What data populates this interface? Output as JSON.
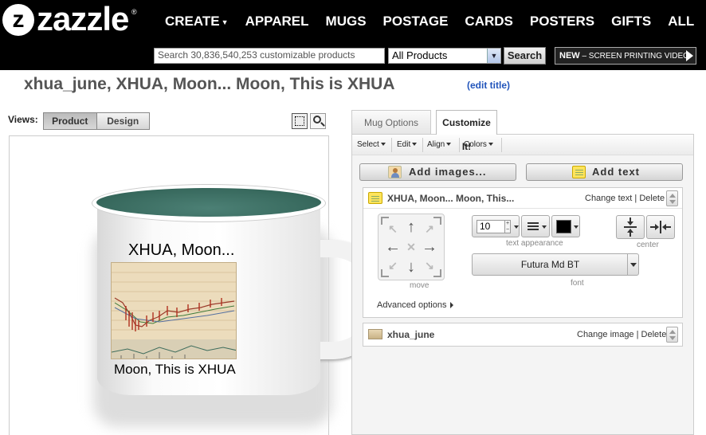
{
  "header": {
    "logo_text": "zazzle",
    "logo_letter": "z",
    "logo_mark": "®",
    "nav": [
      {
        "label": "CREATE",
        "has_caret": true
      },
      {
        "label": "APPAREL"
      },
      {
        "label": "MUGS"
      },
      {
        "label": "POSTAGE"
      },
      {
        "label": "CARDS"
      },
      {
        "label": "POSTERS"
      },
      {
        "label": "GIFTS"
      },
      {
        "label": "ALL"
      }
    ],
    "search": {
      "placeholder": "Search 30,836,540,253 customizable products",
      "category": "All Products",
      "button": "Search"
    },
    "promo": {
      "bold": "NEW",
      "text": " – SCREEN PRINTING VIDEO"
    }
  },
  "page": {
    "title": "xhua_june, XHUA, Moon... Moon, This is XHUA",
    "edit_title": "(edit title)"
  },
  "views": {
    "label": "Views:",
    "options": [
      "Product",
      "Design"
    ],
    "active": "Product"
  },
  "preview": {
    "mug_text_top": "XHUA, Moon...",
    "mug_text_bottom": "Moon, This is XHUA",
    "inside_color": "#2e5e52"
  },
  "panel": {
    "tabs": [
      "Mug Options",
      "Customize It!"
    ],
    "active_tab": "Customize It!",
    "toolbar": [
      "Select",
      "Edit",
      "Align",
      "Colors"
    ],
    "add_images": "Add images...",
    "add_text": "Add text",
    "text_layer": {
      "title": "XHUA, Moon... Moon, This...",
      "change": "Change text",
      "separator": "|",
      "delete": "Delete",
      "move_label": "move",
      "font_size": "10",
      "text_appearance_label": "text appearance",
      "text_color": "#000000",
      "font": "Futura Md BT",
      "font_label": "font",
      "center_label": "center",
      "advanced": "Advanced options"
    },
    "image_layer": {
      "title": "xhua_june",
      "change": "Change image",
      "separator": "|",
      "delete": "Delete"
    }
  }
}
